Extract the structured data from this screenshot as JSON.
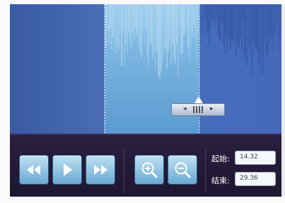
{
  "selection": {
    "start_label": "起始:",
    "start_value": "14.32",
    "end_label": "结束:",
    "end_value": "29.36"
  },
  "icons": {
    "rewind": "rewind-icon",
    "play": "play-icon",
    "fast_forward": "fast-forward-icon",
    "zoom_in": "zoom-in-icon",
    "zoom_out": "zoom-out-icon",
    "handle": "drag-handle-icon"
  },
  "colors": {
    "waveform_dark": "#2f4f9b",
    "waveform_selected": "#8fc3e8",
    "background_left": "#3d5da6",
    "background_selected": "#6fa7d8",
    "controls_bg": "#251b38",
    "button_face": "#9fcbe8"
  }
}
